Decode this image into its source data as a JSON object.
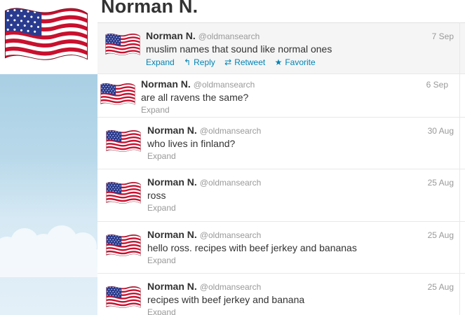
{
  "header": {
    "title": "Norman N."
  },
  "colors": {
    "link": "#0084b4",
    "muted": "#999999",
    "flag_red": "#b22234",
    "flag_blue": "#3c3b6e"
  },
  "icons": {
    "flag": "us-flag-icon",
    "reply": "reply-arrow-icon",
    "retweet": "retweet-icon",
    "favorite": "star-icon"
  },
  "tweets": [
    {
      "name": "Norman N.",
      "handle": "@oldmansearch",
      "date": "7 Sep",
      "text": "muslim names that sound like normal ones",
      "expand": "Expand",
      "reply": "Reply",
      "retweet": "Retweet",
      "favorite": "Favorite"
    },
    {
      "name": "Norman N.",
      "handle": "@oldmansearch",
      "date": "6 Sep",
      "text": "are all ravens the same?",
      "expand": "Expand"
    },
    {
      "name": "Norman N.",
      "handle": "@oldmansearch",
      "date": "30 Aug",
      "text": "who lives in finland?",
      "expand": "Expand"
    },
    {
      "name": "Norman N.",
      "handle": "@oldmansearch",
      "date": "25 Aug",
      "text": "ross",
      "expand": "Expand"
    },
    {
      "name": "Norman N.",
      "handle": "@oldmansearch",
      "date": "25 Aug",
      "text": "hello ross. recipes with beef jerkey and bananas",
      "expand": "Expand"
    },
    {
      "name": "Norman N.",
      "handle": "@oldmansearch",
      "date": "25 Aug",
      "text": "recipes with beef jerkey and banana",
      "expand": "Expand"
    }
  ]
}
